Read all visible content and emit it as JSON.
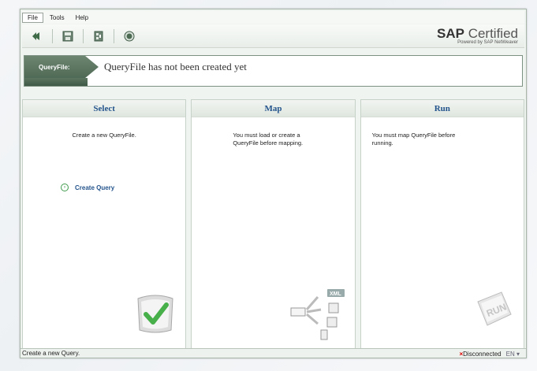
{
  "menu": {
    "items": [
      {
        "label": "File",
        "active": true
      },
      {
        "label": "Tools",
        "active": false
      },
      {
        "label": "Help",
        "active": false
      }
    ]
  },
  "toolbar": {
    "icons": [
      "back-icon",
      "save-icon",
      "export-icon",
      "stop-icon"
    ]
  },
  "brand": {
    "main_bold": "SAP",
    "main_rest": "Certified",
    "sub": "Powered by SAP NetWeaver"
  },
  "queryfile": {
    "label": "QueryFile:",
    "message": "QueryFile has not been created yet"
  },
  "panels": {
    "select": {
      "title": "Select",
      "description": "Create a new QueryFile.",
      "action": "Create Query"
    },
    "map": {
      "title": "Map",
      "description": "You must load or create a QueryFile before mapping.",
      "xml_label": "XML"
    },
    "run": {
      "title": "Run",
      "description": "You must map  QueryFile before running.",
      "illustration_text": "RUN"
    }
  },
  "status": {
    "message": "Create a new Query.",
    "connection": "Disconnected",
    "language": "EN"
  },
  "colors": {
    "accent": "#24548c",
    "header_green": "#5b7561",
    "success": "#3d9a4b",
    "error": "#dd0000"
  }
}
